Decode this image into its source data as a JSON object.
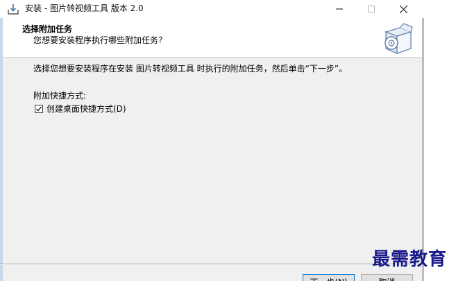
{
  "window": {
    "title": "安装 - 图片转视频工具 版本 2.0"
  },
  "header": {
    "title": "选择附加任务",
    "subtitle": "您想要安装程序执行哪些附加任务？"
  },
  "body": {
    "instruction": "选择您想要安装程序在安装 图片转视频工具 时执行的附加任务，然后单击“下一步”。",
    "shortcuts_label": "附加快捷方式:",
    "desktop_shortcut": {
      "label": "创建桌面快捷方式(D)",
      "checked": true
    }
  },
  "footer": {
    "next_label": "下一步(N)",
    "cancel_label": "取消"
  },
  "watermark": "最需教育",
  "icons": {
    "app": "installer-icon",
    "header": "setup-box-icon",
    "minimize": "minimize-icon",
    "maximize": "maximize-icon",
    "close": "close-icon",
    "checkbox": "checkmark-icon"
  },
  "colors": {
    "accent": "#0078d7",
    "watermark": "#1a1a8c"
  }
}
